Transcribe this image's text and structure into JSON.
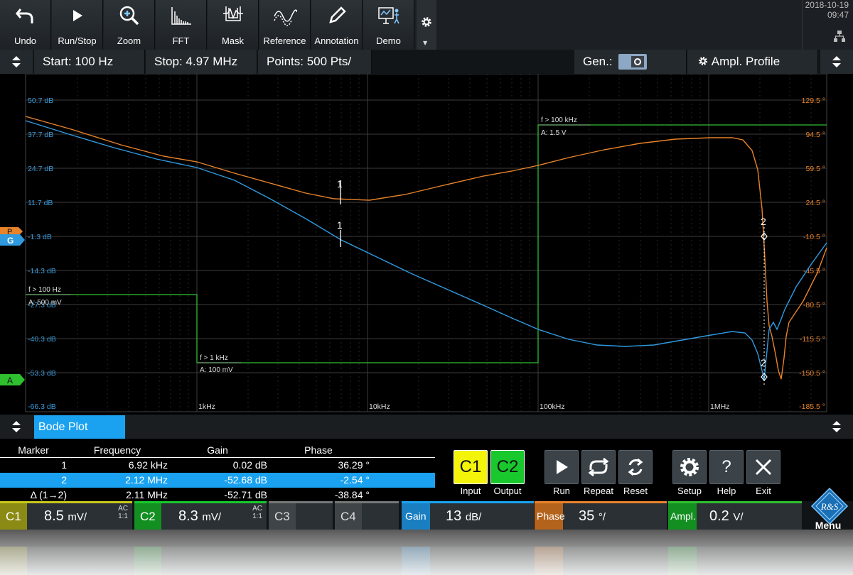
{
  "toolbar": {
    "buttons": [
      {
        "label": "Undo",
        "icon": "undo-icon"
      },
      {
        "label": "Run/Stop",
        "icon": "play-icon"
      },
      {
        "label": "Zoom",
        "icon": "zoom-icon"
      },
      {
        "label": "FFT",
        "icon": "fft-icon"
      },
      {
        "label": "Mask",
        "icon": "mask-icon"
      },
      {
        "label": "Reference",
        "icon": "reference-icon"
      },
      {
        "label": "Annotation",
        "icon": "pencil-icon"
      },
      {
        "label": "Demo",
        "icon": "demo-icon"
      }
    ],
    "date": "2018-10-19",
    "time": "09:47"
  },
  "infobar": {
    "start": "Start: 100 Hz",
    "stop": "Stop: 4.97 MHz",
    "points": "Points: 500 Pts/",
    "gen": "Gen.:",
    "profile": "Ampl. Profile"
  },
  "plot": {
    "left_labels": [
      "50.7 dB",
      "37.7 dB",
      "24.7 dB",
      "11.7 dB",
      "-1.3 dB",
      "-14.3 dB",
      "-27.3 dB",
      "-40.3 dB",
      "-53.3 dB",
      "-66.3 dB"
    ],
    "right_labels": [
      "129.5 °",
      "94.5 °",
      "59.5 °",
      "24.5 °",
      "-10.5 °",
      "-45.5 °",
      "-80.5 °",
      "-115.5 °",
      "-150.5 °",
      "-185.5 °"
    ],
    "x_labels": [
      "1kHz",
      "10kHz",
      "100kHz",
      "1MHz"
    ],
    "profile_steps": [
      {
        "freq": "f > 100 Hz",
        "amp": "A: 500 mV"
      },
      {
        "freq": "f > 1 kHz",
        "amp": "A: 100 mV"
      },
      {
        "freq": "f > 100 kHz",
        "amp": "A: 1.5 V"
      }
    ],
    "marker1": "1",
    "marker2": "2",
    "side_tags": {
      "p": "P",
      "g": "G",
      "a": "A"
    },
    "colors": {
      "gain": "#2f9ae0",
      "phase": "#e8832a",
      "profile": "#2fbf2f",
      "label_blue": "#3a9ad9",
      "label_orange": "#e8832a"
    }
  },
  "tab": {
    "label": "Bode Plot"
  },
  "marker_table": {
    "headers": [
      "Marker",
      "Frequency",
      "Gain",
      "Phase"
    ],
    "rows": [
      {
        "marker": "1",
        "freq": "6.92 kHz",
        "gain": "0.02 dB",
        "phase": "36.29 °"
      },
      {
        "marker": "2",
        "freq": "2.12 MHz",
        "gain": "-52.68 dB",
        "phase": "-2.54 °"
      },
      {
        "marker": "Δ (1→2)",
        "freq": "2.11 MHz",
        "gain": "-52.71 dB",
        "phase": "-38.84 °"
      }
    ]
  },
  "controls": {
    "c1": "C1",
    "c2": "C2",
    "input": "Input",
    "output": "Output",
    "run": "Run",
    "repeat": "Repeat",
    "reset": "Reset",
    "setup": "Setup",
    "help": "Help",
    "exit": "Exit"
  },
  "channels": [
    {
      "tag": "C1",
      "value": "8.5",
      "unit": "mV/",
      "ac": "AC",
      "ratio": "1:1"
    },
    {
      "tag": "C2",
      "value": "8.3",
      "unit": "mV/",
      "ac": "AC",
      "ratio": "1:1"
    },
    {
      "tag": "C3"
    },
    {
      "tag": "C4"
    },
    {
      "tag": "Gain",
      "value": "13",
      "unit": "dB/"
    },
    {
      "tag": "Phase",
      "value": "35",
      "unit": "°/"
    },
    {
      "tag": "Ampl.",
      "value": "0.2",
      "unit": "V/"
    }
  ],
  "menu": {
    "label": "Menu",
    "logo": "R&S"
  }
}
